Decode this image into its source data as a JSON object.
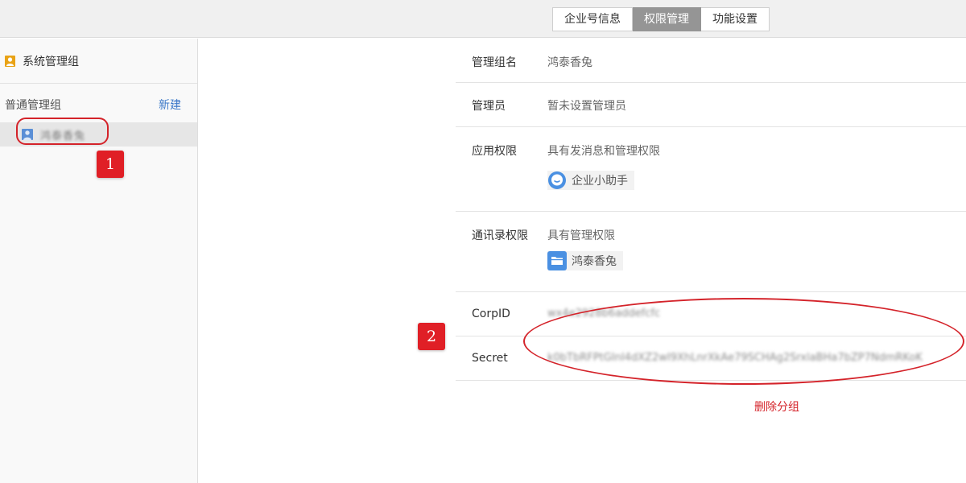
{
  "tabs": [
    {
      "label": "企业号信息",
      "active": false
    },
    {
      "label": "权限管理",
      "active": true
    },
    {
      "label": "功能设置",
      "active": false
    }
  ],
  "sidebar": {
    "system_group": "系统管理组",
    "normal_group_title": "普通管理组",
    "new_button": "新建",
    "groups": [
      {
        "label": "鸿泰香兔",
        "selected": true
      }
    ]
  },
  "annotations": {
    "badge1": "1",
    "badge2": "2"
  },
  "details": {
    "group_name": {
      "label": "管理组名",
      "value": "鸿泰香兔"
    },
    "admin": {
      "label": "管理员",
      "value": "暂未设置管理员"
    },
    "app_perm": {
      "label": "应用权限",
      "value": "具有发消息和管理权限",
      "chip": "企业小助手"
    },
    "contacts_perm": {
      "label": "通讯录权限",
      "value": "具有管理权限",
      "chip": "鸿泰香兔"
    },
    "corpid": {
      "label": "CorpID",
      "value": "wx4e2928b6addefcfc"
    },
    "secret": {
      "label": "Secret",
      "value": "k0bTbRFPtGInI4dXZ2wI9XhLnrXkAe79SCHAg2SrxlaBHa7bZP7NdmRKoK"
    },
    "delete_button": "删除分组"
  },
  "colors": {
    "accent_red": "#d4232a",
    "link_blue": "#3c78c8",
    "active_tab": "#959595"
  }
}
